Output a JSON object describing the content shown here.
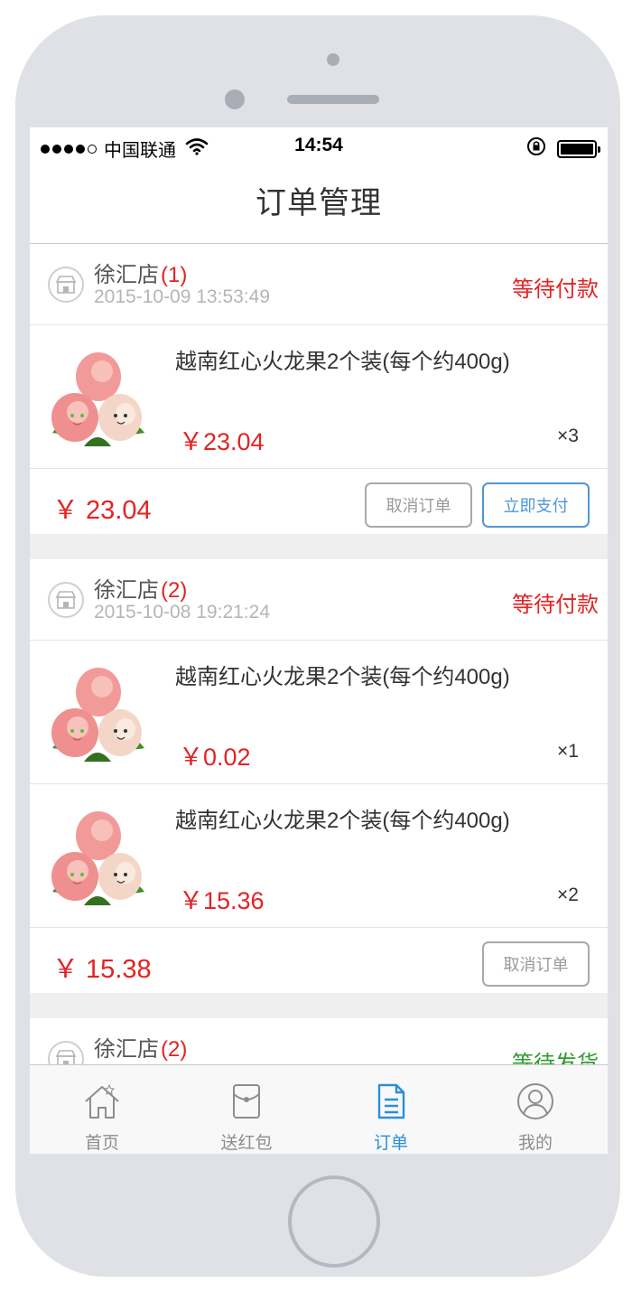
{
  "statusbar": {
    "carrier": "中国联通",
    "time": "14:54"
  },
  "header": {
    "title": "订单管理"
  },
  "orders": [
    {
      "shop": "徐汇店",
      "count": "(1)",
      "time": "2015-10-09 13:53:49",
      "status": "等待付款",
      "status_color": "#e32323",
      "items": [
        {
          "title": "越南红心火龙果2个装(每个约400g)",
          "price": "￥23.04",
          "qty": "×3"
        }
      ],
      "total": "￥ 23.04",
      "cancel_label": "取消订单",
      "pay_label": "立即支付"
    },
    {
      "shop": "徐汇店",
      "count": "(2)",
      "time": "2015-10-08 19:21:24",
      "status": "等待付款",
      "status_color": "#e32323",
      "items": [
        {
          "title": "越南红心火龙果2个装(每个约400g)",
          "price": "￥0.02",
          "qty": "×1"
        },
        {
          "title": "越南红心火龙果2个装(每个约400g)",
          "price": "￥15.36",
          "qty": "×2"
        }
      ],
      "total": "￥ 15.38",
      "cancel_label": "取消订单"
    },
    {
      "shop": "徐汇店",
      "count": "(2)",
      "status": "等待发货",
      "status_color": "#2f9d2f"
    }
  ],
  "tabbar": {
    "tabs": [
      {
        "label": "首页",
        "icon": "home-icon"
      },
      {
        "label": "送红包",
        "icon": "red-envelope-icon"
      },
      {
        "label": "订单",
        "icon": "order-document-icon",
        "active": true
      },
      {
        "label": "我的",
        "icon": "user-profile-icon"
      }
    ],
    "active_color": "#2a8fd8"
  }
}
